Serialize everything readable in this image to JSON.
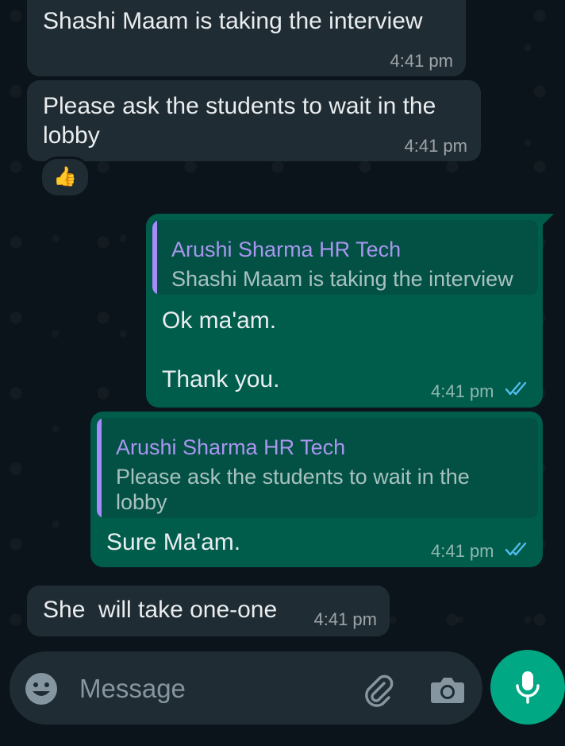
{
  "messages": [
    {
      "text": "Shashi Maam is taking the interview",
      "time": "4:41 pm"
    },
    {
      "text": "Please ask the students to wait in the\nlobby",
      "time": "4:41 pm",
      "reaction": "👍"
    },
    {
      "quote_author": "Arushi Sharma HR Tech",
      "quote_text": "Shashi Maam is taking the interview",
      "text": "Ok ma'am.\n\nThank you.",
      "time": "4:41 pm"
    },
    {
      "quote_author": "Arushi Sharma HR Tech",
      "quote_text": "Please ask the students to wait in the\nlobby",
      "text": "Sure Ma'am.",
      "time": "4:41 pm"
    },
    {
      "text": "She  will take one-one",
      "time": "4:41 pm"
    }
  ],
  "composer": {
    "placeholder": "Message"
  },
  "icons": {
    "emoji": "emoji-icon",
    "attach": "paperclip-icon",
    "camera": "camera-icon",
    "mic": "mic-icon",
    "read": "double-check-icon"
  },
  "colors": {
    "background": "#0b141a",
    "incoming": "#202c33",
    "outgoing": "#005c4b",
    "quote_author": "#a996f0",
    "read_ticks": "#53bdeb",
    "send_button": "#00a884"
  }
}
